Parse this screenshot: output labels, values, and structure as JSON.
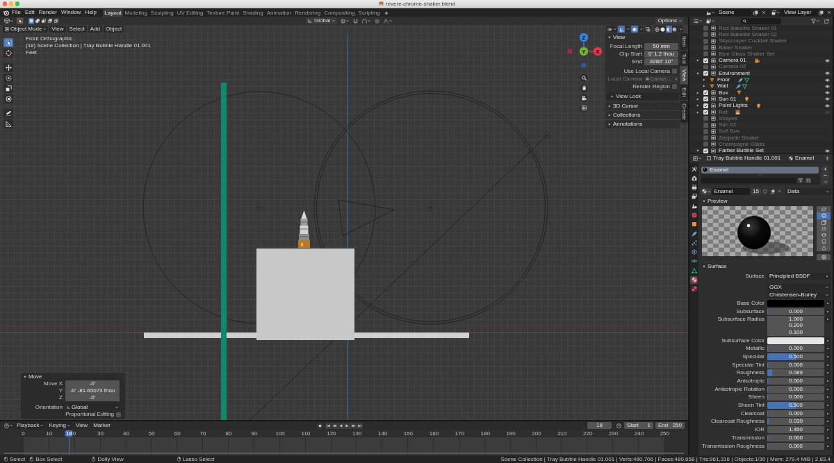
{
  "window": {
    "title": "revere-chrome-shaker.blend"
  },
  "top_bar": {
    "menus": [
      "File",
      "Edit",
      "Render",
      "Window",
      "Help"
    ],
    "workspaces": [
      {
        "label": "Layout",
        "selected": true
      },
      {
        "label": "Modeling",
        "selected": false
      },
      {
        "label": "Sculpting",
        "selected": false
      },
      {
        "label": "UV Editing",
        "selected": false
      },
      {
        "label": "Texture Paint",
        "selected": false
      },
      {
        "label": "Shading",
        "selected": false
      },
      {
        "label": "Animation",
        "selected": false
      },
      {
        "label": "Rendering",
        "selected": false
      },
      {
        "label": "Compositing",
        "selected": false
      },
      {
        "label": "Scripting",
        "selected": false
      }
    ],
    "scene": "Scene",
    "view_layer": "View Layer"
  },
  "viewport": {
    "tool_header": {
      "select_modes": [
        {
          "selected": true
        },
        {
          "selected": false
        },
        {
          "selected": false
        },
        {
          "selected": false
        },
        {
          "selected": false
        }
      ],
      "orientation": "Global",
      "options": "Options"
    },
    "header": {
      "mode": "Object Mode",
      "menus": [
        "View",
        "Select",
        "Add",
        "Object"
      ],
      "gizmos_on": true,
      "overlays_on": true,
      "xray_on": false,
      "shading_modes": [
        {
          "kind": "wireframe",
          "selected": false
        },
        {
          "kind": "solid",
          "selected": false
        },
        {
          "kind": "material",
          "selected": true
        },
        {
          "kind": "rendered",
          "selected": false
        }
      ]
    },
    "tools": [
      {
        "kind": "select_box",
        "selected": true
      },
      {
        "kind": "cursor",
        "selected": false
      },
      {
        "kind": "move",
        "selected": false
      },
      {
        "kind": "rotate",
        "selected": false
      },
      {
        "kind": "scale",
        "selected": false
      },
      {
        "kind": "transform",
        "selected": false
      },
      {
        "kind": "annotate",
        "selected": false
      },
      {
        "kind": "measure",
        "selected": false
      }
    ],
    "overlay_text": [
      "Front Orthographic",
      "(18) Scene Collection | Tray Bubble Handle 01.001",
      "Feet"
    ],
    "gizmo_axes": [
      "Z",
      "Y",
      "X"
    ],
    "sidebar": {
      "tabs": [
        {
          "label": "Item",
          "selected": false
        },
        {
          "label": "Tool",
          "selected": false
        },
        {
          "label": "View",
          "selected": true
        },
        {
          "label": "Edit",
          "selected": false
        },
        {
          "label": "Create",
          "selected": false
        }
      ],
      "panels": [
        {
          "title": "View",
          "expanded": true,
          "fields": [
            {
              "label": "Focal Length",
              "value": "50 mm"
            },
            {
              "label": "Clip Start",
              "value": "0' 1.2 thou"
            },
            {
              "label": "End",
              "value": "3280' 10\""
            }
          ],
          "options": [
            {
              "kind": "checkbox",
              "label": "Use Local Camera",
              "checked": false,
              "disabled": false
            },
            {
              "kind": "object",
              "label": "Local Camera",
              "value": "Camer...",
              "disabled": true
            },
            {
              "kind": "checkbox",
              "label": "Render Region",
              "checked": false,
              "disabled": false
            }
          ],
          "subpanels": [
            {
              "title": "View Lock",
              "expanded": false
            }
          ]
        },
        {
          "title": "3D Cursor",
          "expanded": false
        },
        {
          "title": "Collections",
          "expanded": false
        },
        {
          "title": "Annotations",
          "expanded": false
        }
      ]
    },
    "operator_panel": {
      "title": "Move",
      "expanded": true,
      "rows": [
        {
          "kind": "field",
          "label": "Move X",
          "value": "-0'"
        },
        {
          "kind": "field",
          "label": "Y",
          "value": "-0' -81.65073 thou"
        },
        {
          "kind": "field",
          "label": "Z",
          "value": "-0'"
        },
        {
          "kind": "dropdown",
          "label": "Orientation",
          "value": "Global"
        },
        {
          "kind": "checkbox",
          "label": "Proportional Editing",
          "checked": false
        }
      ]
    }
  },
  "timeline": {
    "menus": [
      {
        "label": "Playback",
        "dropdown": true
      },
      {
        "label": "Keying",
        "dropdown": true
      },
      {
        "label": "View",
        "dropdown": false
      },
      {
        "label": "Marker",
        "dropdown": false
      }
    ],
    "current_frame": "18",
    "start": {
      "label": "Start",
      "value": "1"
    },
    "end": {
      "label": "End",
      "value": "250"
    },
    "ruler": [
      "0",
      "10",
      "0",
      "30",
      "40",
      "50",
      "60",
      "70",
      "80",
      "90",
      "100",
      "110",
      "120",
      "130",
      "140",
      "150",
      "160",
      "170",
      "180",
      "190",
      "200",
      "210",
      "220",
      "230",
      "240",
      "250"
    ],
    "playhead": {
      "label": "18",
      "level": 0.072
    }
  },
  "outliner": {
    "items": [
      {
        "name": "Red Bakelite Shaker 01",
        "kind": "collection",
        "checked": false
      },
      {
        "name": "Red Bakelite Shaker 02",
        "kind": "collection",
        "checked": false
      },
      {
        "name": "Skyscraper Cocktail Shaker",
        "kind": "collection",
        "checked": false
      },
      {
        "name": "Baker Shaker",
        "kind": "collection",
        "checked": false
      },
      {
        "name": "Blue Glass Shaker Set",
        "kind": "collection",
        "checked": false
      },
      {
        "name": "Camera 01",
        "kind": "collection",
        "checked": true,
        "expanded": false,
        "hidden": false,
        "contents": [
          {
            "kind": "camera"
          }
        ]
      },
      {
        "name": "Camera 02",
        "kind": "collection",
        "checked": false
      },
      {
        "name": "Environment",
        "kind": "collection",
        "checked": true,
        "expanded": true,
        "hidden": false,
        "children": [
          {
            "name": "Floor",
            "kind": "object",
            "expanded": false,
            "hidden": false,
            "contents": [
              {
                "kind": "wrench"
              },
              {
                "kind": "mesh_data"
              }
            ]
          },
          {
            "name": "Wall",
            "kind": "object",
            "expanded": false,
            "hidden": false,
            "contents": [
              {
                "kind": "wrench"
              },
              {
                "kind": "mesh_data"
              }
            ]
          }
        ]
      },
      {
        "name": "Box",
        "kind": "collection",
        "checked": true,
        "expanded": false,
        "hidden": false,
        "contents": [
          {
            "kind": "mesh"
          }
        ]
      },
      {
        "name": "Sun 01",
        "kind": "collection",
        "checked": true,
        "expanded": false,
        "hidden": false,
        "contents": [
          {
            "kind": "light"
          }
        ]
      },
      {
        "name": "Point Lights",
        "kind": "collection",
        "checked": true,
        "expanded": false,
        "hidden": false,
        "contents": [
          {
            "kind": "lights"
          }
        ]
      },
      {
        "name": "Ref",
        "kind": "collection",
        "checked": true,
        "expanded": false,
        "hidden": true,
        "contents": [
          {
            "kind": "image"
          }
        ]
      },
      {
        "name": "Shapes",
        "kind": "collection",
        "checked": false
      },
      {
        "name": "Sun 02",
        "kind": "collection",
        "checked": false
      },
      {
        "name": "Soft Box",
        "kind": "collection",
        "checked": false
      },
      {
        "name": "Zeppelin Shaker",
        "kind": "collection",
        "checked": false
      },
      {
        "name": "Champagne Glass",
        "kind": "collection",
        "checked": false
      },
      {
        "name": "Farber Bubble Set",
        "kind": "collection",
        "checked": true,
        "expanded": true,
        "hidden": false
      }
    ]
  },
  "properties": {
    "tabs": [
      {
        "kind": "tool",
        "selected": false
      },
      {
        "kind": "render",
        "selected": false
      },
      {
        "kind": "output",
        "selected": false
      },
      {
        "kind": "view_layer",
        "selected": false
      },
      {
        "kind": "scene",
        "selected": false
      },
      {
        "kind": "world",
        "selected": false
      },
      {
        "kind": "object",
        "selected": false
      },
      {
        "kind": "modifiers",
        "selected": false
      },
      {
        "kind": "particles",
        "selected": false
      },
      {
        "kind": "physics",
        "selected": false
      },
      {
        "kind": "constraints",
        "selected": false
      },
      {
        "kind": "data",
        "selected": false
      },
      {
        "kind": "material",
        "selected": true
      },
      {
        "kind": "texture",
        "selected": false
      }
    ],
    "breadcrumb": {
      "object": "Tray Bubble Handle 01.001",
      "material": "Enamel"
    },
    "slots": [
      {
        "name": "Enamel",
        "selected": true
      }
    ],
    "material": {
      "name": "Enamel",
      "users": "15",
      "link": "Data"
    },
    "preview": {
      "title": "Preview",
      "expanded": true,
      "shapes": [
        {
          "kind": "plane",
          "selected": false
        },
        {
          "kind": "sphere",
          "selected": true
        },
        {
          "kind": "cube",
          "selected": false
        },
        {
          "kind": "hair",
          "selected": false
        },
        {
          "kind": "monkey",
          "selected": false
        },
        {
          "kind": "cloth",
          "selected": false
        },
        {
          "kind": "fluid",
          "selected": false
        }
      ]
    },
    "surface": {
      "title": "Surface",
      "expanded": true,
      "inputs": [
        {
          "kind": "node",
          "label": "Surface",
          "value": "Principled BSDF"
        },
        {
          "kind": "dropdown",
          "value": "GGX"
        },
        {
          "kind": "dropdown",
          "value": "Christensen-Burley"
        },
        {
          "kind": "color",
          "label": "Base Color",
          "color": "#000000"
        },
        {
          "kind": "slider",
          "label": "Subsurface",
          "value": "0.000",
          "level": 0
        },
        {
          "kind": "vector",
          "label": "Subsurface Radius",
          "values": [
            "1.000",
            "0.200",
            "0.100"
          ]
        },
        {
          "kind": "color",
          "label": "Subsurface Color",
          "color": "#e6e6e6"
        },
        {
          "kind": "slider",
          "label": "Metallic",
          "value": "0.000",
          "level": 0
        },
        {
          "kind": "slider",
          "label": "Specular",
          "value": "0.500",
          "level": 0.5
        },
        {
          "kind": "slider",
          "label": "Specular Tint",
          "value": "0.000",
          "level": 0
        },
        {
          "kind": "slider",
          "label": "Roughness",
          "value": "0.089",
          "level": 0.089
        },
        {
          "kind": "slider",
          "label": "Anisotropic",
          "value": "0.000",
          "level": 0
        },
        {
          "kind": "slider",
          "label": "Anisotropic Rotation",
          "value": "0.000",
          "level": 0
        },
        {
          "kind": "slider",
          "label": "Sheen",
          "value": "0.000",
          "level": 0
        },
        {
          "kind": "slider",
          "label": "Sheen Tint",
          "value": "0.500",
          "level": 0.5
        },
        {
          "kind": "slider",
          "label": "Clearcoat",
          "value": "0.000",
          "level": 0
        },
        {
          "kind": "slider",
          "label": "Clearcoat Roughness",
          "value": "0.030",
          "level": 0.03
        },
        {
          "kind": "number",
          "label": "IOR",
          "value": "1.450"
        },
        {
          "kind": "slider",
          "label": "Transmission",
          "value": "0.000",
          "level": 0
        },
        {
          "kind": "slider",
          "label": "Transmission Roughness",
          "value": "0.000",
          "level": 0
        }
      ]
    }
  },
  "status_bar": {
    "hints": [
      {
        "kind": "left",
        "label": "Select"
      },
      {
        "kind": "left",
        "label": "Box Select"
      },
      {
        "kind": "middle",
        "label": "Dolly View"
      },
      {
        "kind": "right",
        "label": "Lasso Select"
      }
    ],
    "stats": "Scene Collection | Tray Bubble Handle 01.001 | Verts:480,706 | Faces:480,658 | Tris:961,316 | Objects:1/30 | Mem: 279.4 MiB | 2.83.4"
  }
}
